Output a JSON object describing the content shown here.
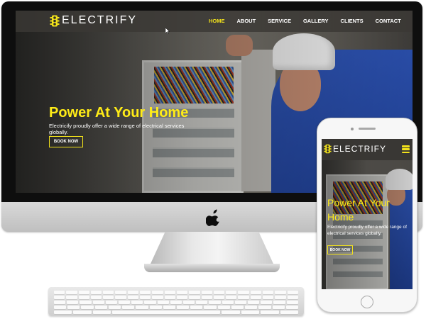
{
  "colors": {
    "accent": "#f2e21b",
    "hero_title": "#ffec17",
    "nav_active": "#f2e21b",
    "text": "#ffffff"
  },
  "desktop": {
    "brand": {
      "name": "ELECTRIFY",
      "icon": "traffic-light-icon"
    },
    "nav": {
      "items": [
        "HOME",
        "ABOUT",
        "SERVICE",
        "GALLERY",
        "CLIENTS",
        "CONTACT"
      ],
      "active": "HOME"
    },
    "hero": {
      "title": "Power At Your Home",
      "text": "Electricify proudly offer a wide range of electrical services globally.",
      "button": "BOOK NOW"
    },
    "device_logo": "apple-icon"
  },
  "mobile": {
    "brand": {
      "name": "ELECTRIFY",
      "icon": "traffic-light-icon"
    },
    "menu_icon": "hamburger-menu-icon",
    "hero": {
      "title": "Power At Your Home",
      "text": "Electricify proudly offer a wide range of electrical services globally.",
      "button": "BOOK NOW"
    }
  }
}
